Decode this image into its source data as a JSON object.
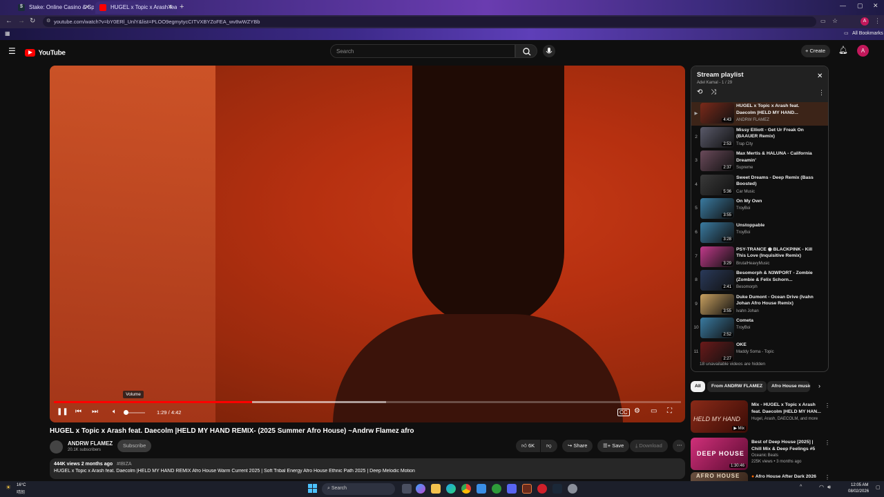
{
  "browser": {
    "tabs": [
      {
        "label": "Stake: Online Casino & Sports",
        "active": false
      },
      {
        "label": "HUGEL x Topic x Arash feat.",
        "active": true
      }
    ],
    "url": "youtube.com/watch?v=bY0ERl_UnlY&list=PLOO9egmytycCITVXBYZoFEA_wv8wWZYBb",
    "all_bookmarks_label": "All Bookmarks",
    "profile_initial": "A"
  },
  "youtube": {
    "logo_text": "YouTube",
    "search_placeholder": "Search",
    "create_label": "Create",
    "avatar_initial": "A"
  },
  "player": {
    "time_display": "1:29 / 4:42",
    "progress_fraction": 0.316,
    "buffered_fraction": 0.53,
    "volume_tooltip": "Volume",
    "volume_fraction": 0.08
  },
  "video": {
    "title": "HUGEL x Topic x Arash feat. Daecolm |HELD MY HAND REMIX- (2025 Summer Afro House) ~Andrw Flamez afro",
    "channel_name": "ANDRW FLAMEZ",
    "subscribers": "20.1K subscribers",
    "subscribe_label": "Subscribe",
    "like_count": "6K",
    "share_label": "Share",
    "save_label": "Save",
    "download_label": "Download",
    "views_line": "444K views  2 months ago",
    "hashtag": "#IBIZA",
    "description": "HUGEL x Topic x Arash feat. Daecolm |HELD MY HAND REMIX Afro House Warm Current 2025 | Soft Tribal Energy Afro House Ethnic Path 2025 | Deep Melodic Motion"
  },
  "playlist": {
    "title": "Stream playlist",
    "subtitle": "Adel Kamal - 1 / 29",
    "hidden_note": "18 unavailable videos are hidden",
    "items": [
      {
        "index": "▶",
        "title": "HUGEL x Topic x Arash feat. Daecolm |HELD MY HAND...",
        "channel": "ANDRW FLAMEZ",
        "duration": "4:43",
        "color": "#7a2a1a"
      },
      {
        "index": "2",
        "title": "Missy Elliott - Get Ur Freak On (BAAUER Remix)",
        "channel": "Trap City",
        "duration": "2:53",
        "color": "#5a5a6a"
      },
      {
        "index": "3",
        "title": "Max Mertis & HALUNA - California Dreamin'",
        "channel": "Supreme",
        "duration": "2:37",
        "color": "#6a4a5a"
      },
      {
        "index": "4",
        "title": "Sweet Dreams - Deep Remix (Bass Boosted)",
        "channel": "Car Music",
        "duration": "5:36",
        "color": "#3a3a3a"
      },
      {
        "index": "5",
        "title": "On My Own",
        "channel": "TroyBoi",
        "duration": "3:55",
        "color": "#3a7aa0"
      },
      {
        "index": "6",
        "title": "Unstoppable",
        "channel": "TroyBoi",
        "duration": "3:28",
        "color": "#3a7aa0"
      },
      {
        "index": "7",
        "title": "PSY-TRANCE ◉ BLACKPINK - Kill This Love (Inquisitive Remix)",
        "channel": "BrutalHeavyMusic",
        "duration": "3:29",
        "color": "#c03a8a"
      },
      {
        "index": "8",
        "title": "Besomorph & N3WPORT - Zombie (Zombie & Felix Schorn...",
        "channel": "Besomorph",
        "duration": "2:41",
        "color": "#2a3a5a"
      },
      {
        "index": "9",
        "title": "Duke Dumont - Ocean Drive (Ivahn Johan Afro House Remix)",
        "channel": "Ivahn Johan",
        "duration": "3:55",
        "color": "#c8a060"
      },
      {
        "index": "10",
        "title": "Cometa",
        "channel": "TroyBoi",
        "duration": "2:52",
        "color": "#3a7aa0"
      },
      {
        "index": "11",
        "title": "OKE",
        "channel": "Maddy Soma - Topic",
        "duration": "2:27",
        "color": "#6a1a1a"
      }
    ]
  },
  "chips": [
    "All",
    "From ANDRW FLAMEZ",
    "Afro House music"
  ],
  "recommendations": [
    {
      "title": "Mix - HUGEL x Topic x Arash feat. Daecolm |HELD MY HAN...",
      "sub1": "Hugel, Arash, DAECOLM, and more",
      "sub2": "",
      "badge": "Mix",
      "thumb_text": "HELD MY HAND",
      "color": "#7a2a1a"
    },
    {
      "title": "Best of Deep House [2025] | Chill Mix & Deep Feelings #5",
      "sub1": "Oceanic Beats",
      "sub2": "225K views • 3 months ago",
      "badge": "1:30:46",
      "thumb_text": "DEEP HOUSE",
      "color": "#b0206a"
    },
    {
      "title": "Afro House After Dark 2026",
      "sub1": "",
      "sub2": "",
      "badge": "",
      "thumb_text": "AFRO HOUSE",
      "color": "#4a3a2a"
    }
  ],
  "taskbar": {
    "weather_temp": "16°C",
    "weather_desc": "晴朗",
    "search_label": "Search",
    "time": "12:05 AM",
    "date": "08/02/2026"
  }
}
